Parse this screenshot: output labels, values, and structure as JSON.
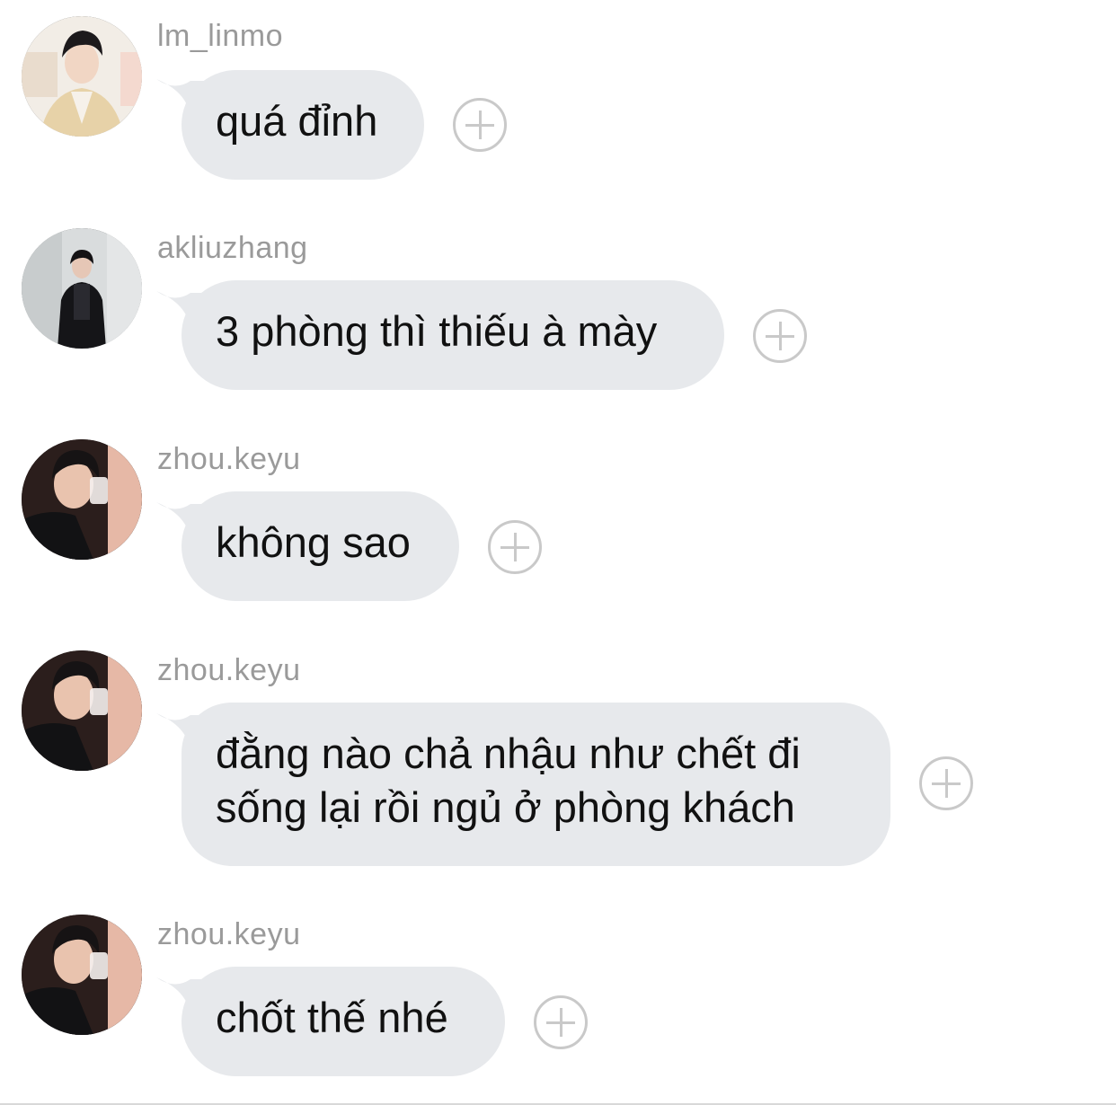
{
  "messages": [
    {
      "username": "lm_linmo",
      "lines": [
        "quá đỉnh"
      ],
      "avatar_icon": "avatar-photo-lm-linmo"
    },
    {
      "username": "akliuzhang",
      "lines": [
        "3 phòng thì thiếu à mày"
      ],
      "avatar_icon": "avatar-photo-akliuzhang"
    },
    {
      "username": "zhou.keyu",
      "lines": [
        "không sao"
      ],
      "avatar_icon": "avatar-photo-zhou-keyu"
    },
    {
      "username": "zhou.keyu",
      "lines": [
        "đằng nào chả nhậu như chết đi",
        "sống lại rồi ngủ ở phòng khách"
      ],
      "avatar_icon": "avatar-photo-zhou-keyu"
    },
    {
      "username": "zhou.keyu",
      "lines": [
        "chốt thế nhé"
      ],
      "avatar_icon": "avatar-photo-zhou-keyu"
    }
  ],
  "reaction_icon": "add-reaction-plus-icon",
  "colors": {
    "bubble": "#e7e9ec",
    "username": "#9a9a9a",
    "text": "#111111",
    "plus": "#c9c9c9"
  }
}
